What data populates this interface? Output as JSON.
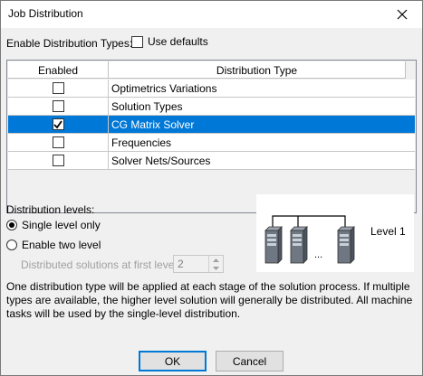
{
  "window": {
    "title": "Job Distribution",
    "close_icon": "close-icon"
  },
  "enable": {
    "label": "Enable Distribution Types:",
    "use_defaults_label": "Use defaults",
    "use_defaults_checked": false
  },
  "grid": {
    "columns": [
      "Enabled",
      "Distribution Type"
    ],
    "rows": [
      {
        "label": "Optimetrics Variations",
        "enabled": false,
        "selected": false
      },
      {
        "label": "Solution Types",
        "enabled": false,
        "selected": false
      },
      {
        "label": "CG Matrix Solver",
        "enabled": true,
        "selected": true
      },
      {
        "label": "Frequencies",
        "enabled": false,
        "selected": false
      },
      {
        "label": "Solver Nets/Sources",
        "enabled": false,
        "selected": false
      }
    ]
  },
  "levels": {
    "label": "Distribution levels:",
    "single_label": "Single level only",
    "two_label": "Enable two level",
    "selected": "single",
    "first_level_label": "Distributed solutions at first level:",
    "first_level_value": "2"
  },
  "diagram": {
    "level_label": "Level 1",
    "ellipsis": "..."
  },
  "description": "One distribution type will be applied at each stage of the solution process. If multiple types are available, the higher level solution will generally be distributed. All machine tasks will be used by the single-level distribution.",
  "buttons": {
    "ok": "OK",
    "cancel": "Cancel"
  },
  "colors": {
    "selection": "#0078d7",
    "dialog_bg": "#f0f0f0"
  }
}
